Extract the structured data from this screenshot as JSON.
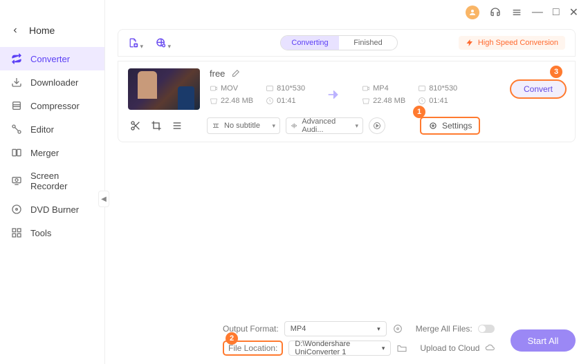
{
  "titlebar": {
    "minimize": "—",
    "maximize": "□",
    "close": "✕"
  },
  "home_label": "Home",
  "sidebar": {
    "items": [
      {
        "label": "Converter"
      },
      {
        "label": "Downloader"
      },
      {
        "label": "Compressor"
      },
      {
        "label": "Editor"
      },
      {
        "label": "Merger"
      },
      {
        "label": "Screen Recorder"
      },
      {
        "label": "DVD Burner"
      },
      {
        "label": "Tools"
      }
    ]
  },
  "tabs": {
    "converting": "Converting",
    "finished": "Finished"
  },
  "hsc_label": "High Speed Conversion",
  "file": {
    "name": "free",
    "src": {
      "format": "MOV",
      "res": "810*530",
      "size": "22.48 MB",
      "dur": "01:41"
    },
    "dst": {
      "format": "MP4",
      "res": "810*530",
      "size": "22.48 MB",
      "dur": "01:41"
    }
  },
  "convert_label": "Convert",
  "dropdowns": {
    "subtitle": "No subtitle",
    "audio": "Advanced Audi..."
  },
  "settings_label": "Settings",
  "footer": {
    "output_format_label": "Output Format:",
    "output_format_value": "MP4",
    "file_location_label": "File Location:",
    "file_location_value": "D:\\Wondershare UniConverter 1",
    "merge_label": "Merge All Files:",
    "upload_label": "Upload to Cloud"
  },
  "start_all_label": "Start All",
  "callouts": {
    "c1": "1",
    "c2": "2",
    "c3": "3"
  }
}
